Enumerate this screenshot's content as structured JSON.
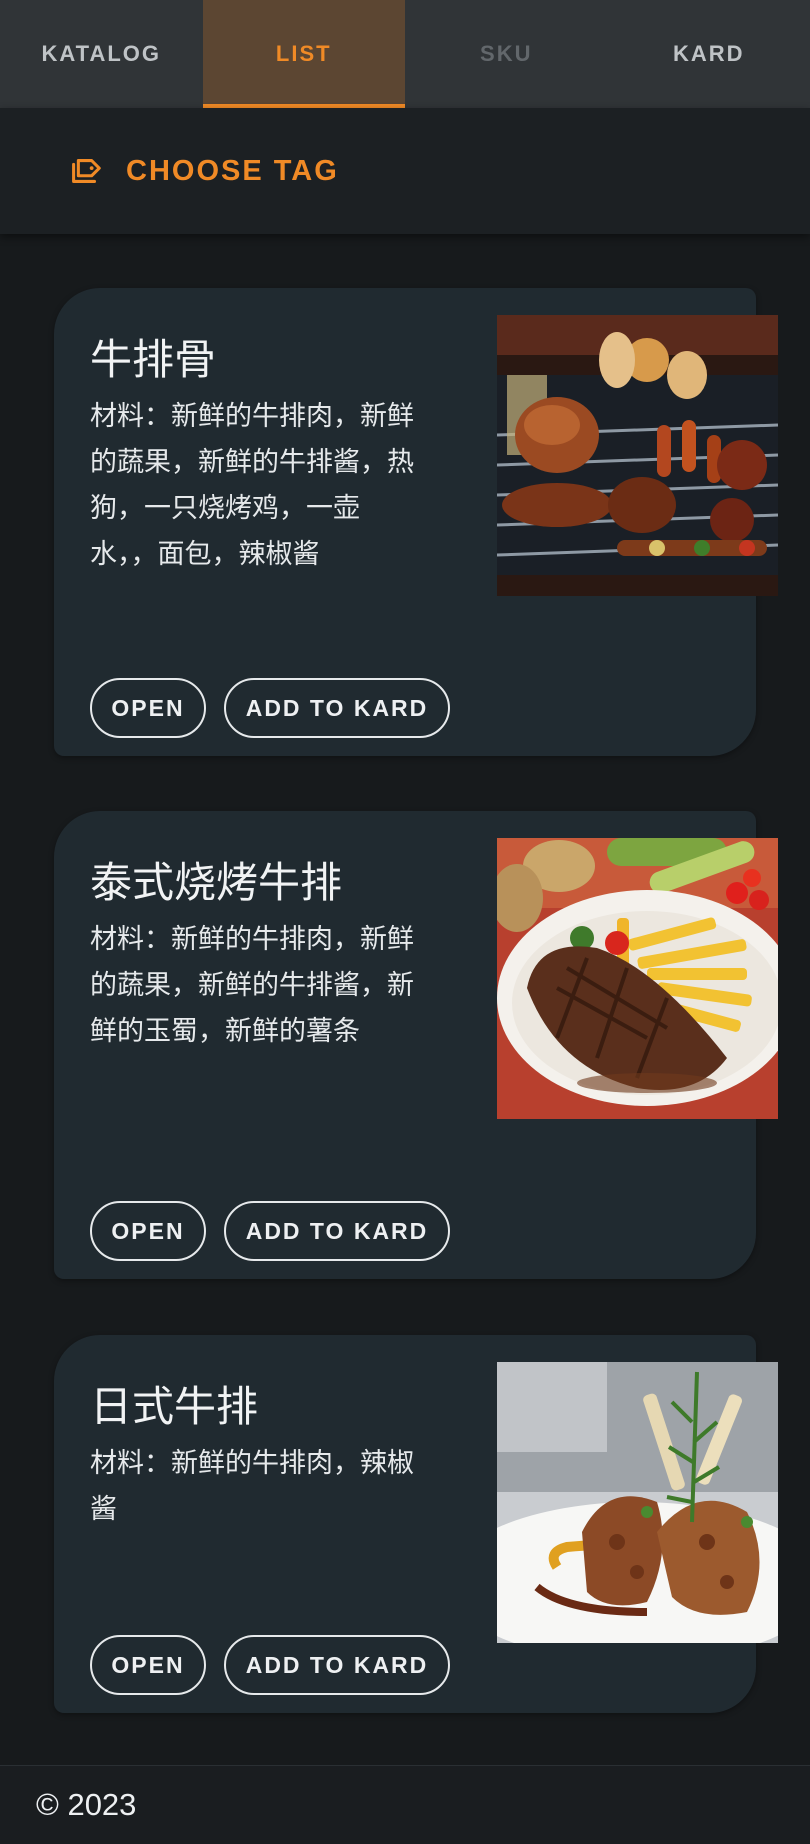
{
  "tabs": [
    {
      "label": "KATALOG",
      "state": "normal"
    },
    {
      "label": "LIST",
      "state": "active"
    },
    {
      "label": "SKU",
      "state": "disabled"
    },
    {
      "label": "KARD",
      "state": "normal"
    }
  ],
  "tag_button": {
    "label": "CHOOSE TAG",
    "icon": "tag-icon"
  },
  "products": [
    {
      "title": "牛排骨",
      "description": "材料：新鲜的牛排肉，新鲜的蔬果，新鲜的牛排酱，热狗，一只烧烤鸡，一壶水，，面包，辣椒酱",
      "image": "grilled-meats-photo",
      "open_label": "OPEN",
      "add_label": "ADD TO KARD"
    },
    {
      "title": "泰式烧烤牛排",
      "description": "材料：新鲜的牛排肉，新鲜的蔬果，新鲜的牛排酱，新鲜的玉蜀，新鲜的薯条",
      "image": "steak-fries-photo",
      "open_label": "OPEN",
      "add_label": "ADD TO KARD"
    },
    {
      "title": "日式牛排",
      "description": "材料：新鲜的牛排肉，辣椒酱",
      "image": "japanese-steak-photo",
      "open_label": "OPEN",
      "add_label": "ADD TO KARD"
    }
  ],
  "footer": {
    "copyright": "© 2023"
  },
  "colors": {
    "accent": "#f08a26",
    "card_bg": "#202a30",
    "page_bg": "#171a1c"
  }
}
